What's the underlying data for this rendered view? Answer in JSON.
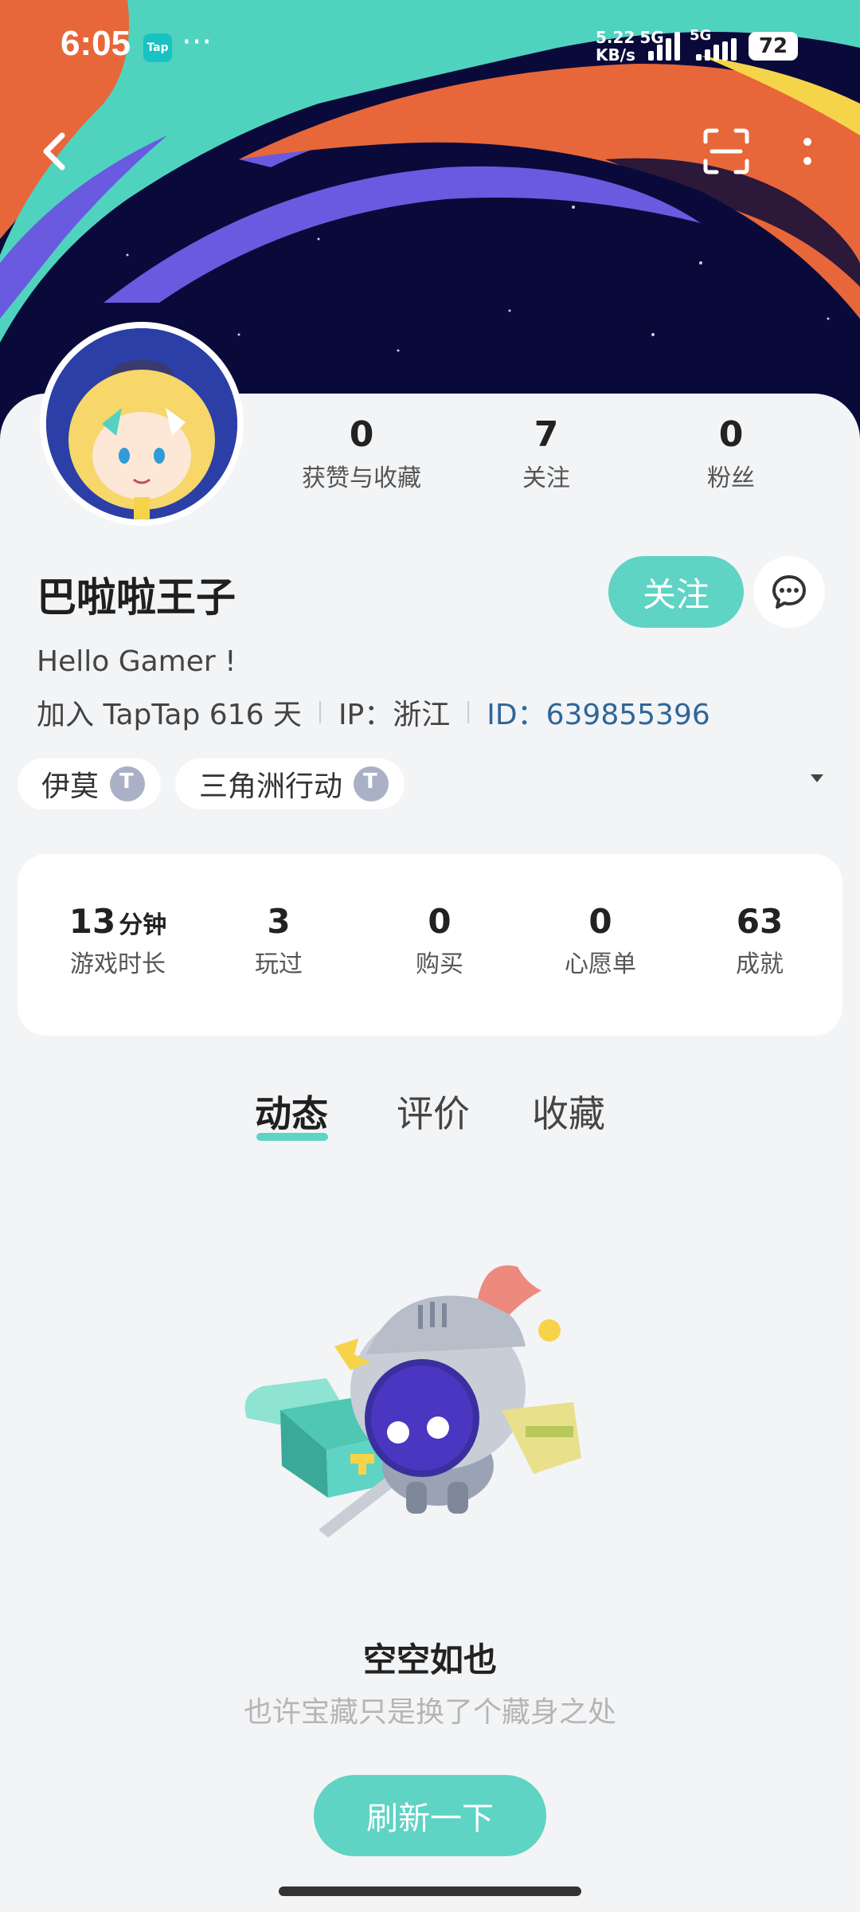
{
  "status_bar": {
    "time": "6:05",
    "app_badge": "Tap",
    "more": "···",
    "net_speed_value": "5.22",
    "net_speed_unit": "KB/s",
    "net_type_1": "5G",
    "net_type_2": "5G",
    "battery": "72"
  },
  "profile": {
    "username": "巴啦啦王子",
    "bio": "Hello Gamer !",
    "join_text": "加入 TapTap 616 天",
    "ip_text": "IP：浙江",
    "id_label": "ID：",
    "id_value": "639855396",
    "follow_label": "关注"
  },
  "top_stats": [
    {
      "value": "0",
      "label": "获赞与收藏"
    },
    {
      "value": "7",
      "label": "关注"
    },
    {
      "value": "0",
      "label": "粉丝"
    }
  ],
  "tags": [
    {
      "label": "伊莫"
    },
    {
      "label": "三角洲行动"
    }
  ],
  "game_stats": [
    {
      "value": "13",
      "unit": "分钟",
      "label": "游戏时长"
    },
    {
      "value": "3",
      "unit": "",
      "label": "玩过"
    },
    {
      "value": "0",
      "unit": "",
      "label": "购买"
    },
    {
      "value": "0",
      "unit": "",
      "label": "心愿单"
    },
    {
      "value": "63",
      "unit": "",
      "label": "成就"
    }
  ],
  "tabs": [
    {
      "label": "动态",
      "active": true
    },
    {
      "label": "评价",
      "active": false
    },
    {
      "label": "收藏",
      "active": false
    }
  ],
  "empty_state": {
    "title": "空空如也",
    "subtitle": "也许宝藏只是换了个藏身之处",
    "button": "刷新一下"
  },
  "colors": {
    "accent": "#5fd3c4",
    "id_link": "#2e6699",
    "banner_bg": "#0a0a3a"
  },
  "icons": [
    "back-arrow-icon",
    "scan-icon",
    "more-vertical-icon",
    "message-icon",
    "taptap-icon",
    "dropdown-caret-icon"
  ]
}
